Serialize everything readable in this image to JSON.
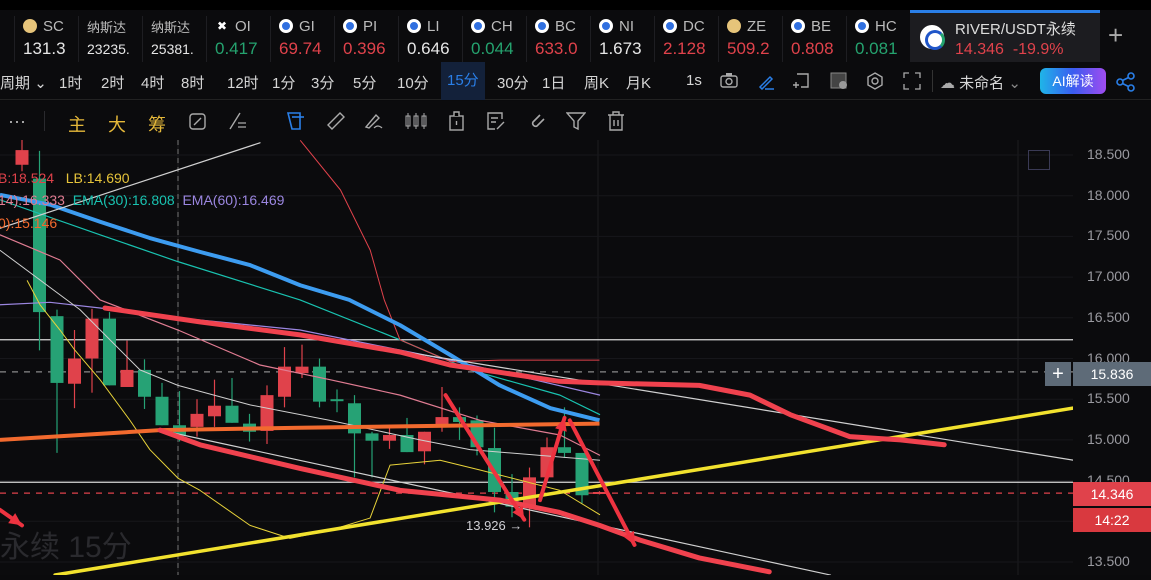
{
  "ticker": [
    {
      "name": "SC",
      "icon": "gold",
      "value": "131.3",
      "color": "w"
    },
    {
      "name": "纳斯达",
      "icon": "",
      "value": "23235.",
      "color": "w"
    },
    {
      "name": "纳斯达",
      "icon": "",
      "value": "25381.",
      "color": "w"
    },
    {
      "name": "OI",
      "icon": "x",
      "value": "0.417",
      "color": "g"
    },
    {
      "name": "GI",
      "icon": "blue",
      "value": "69.74",
      "color": "r"
    },
    {
      "name": "PI",
      "icon": "blue",
      "value": "0.396",
      "color": "r"
    },
    {
      "name": "LI",
      "icon": "blue",
      "value": "0.646",
      "color": "w"
    },
    {
      "name": "CH",
      "icon": "blue",
      "value": "0.044",
      "color": "g"
    },
    {
      "name": "BC",
      "icon": "blue",
      "value": "633.0",
      "color": "r"
    },
    {
      "name": "NI",
      "icon": "blue",
      "value": "1.673",
      "color": "w"
    },
    {
      "name": "DC",
      "icon": "blue",
      "value": "2.128",
      "color": "r"
    },
    {
      "name": "ZE",
      "icon": "gold",
      "value": "509.2",
      "color": "r"
    },
    {
      "name": "BE",
      "icon": "blue",
      "value": "0.808",
      "color": "r"
    },
    {
      "name": "HC",
      "icon": "blue",
      "value": "0.081",
      "color": "g"
    }
  ],
  "active_tab": {
    "symbol": "RIVER/USDT永续",
    "price": "14.346",
    "change": "-19.9%"
  },
  "periods": {
    "label": "周期",
    "items": [
      "1时",
      "2时",
      "4时",
      "8时",
      "12时",
      "1分",
      "3分",
      "5分",
      "10分",
      "15分",
      "30分",
      "1日",
      "周K",
      "月K"
    ],
    "active": "15分",
    "seconds": "1s",
    "layout_name": "未命名",
    "ai_button": "AI解读"
  },
  "tools": {
    "main": "主",
    "big": "大",
    "chips": "筹"
  },
  "legend": {
    "l1a": "B:18.524",
    "l1b": "LB:14.690",
    "l2a": "14):16.333",
    "l2b": "EMA(30):16.808",
    "l2c": "EMA(60):16.469",
    "l3": "0):15.146"
  },
  "watermark": "永续 15分",
  "low_label": "13.926 →",
  "price_axis": {
    "ticks": [
      "18.500",
      "18.000",
      "17.500",
      "17.000",
      "16.500",
      "16.000",
      "15.500",
      "15.000",
      "14.500",
      "14.000",
      "13.500"
    ],
    "crosshair_price": "15.836",
    "last_price": "14.346",
    "countdown": "14:22"
  },
  "colors": {
    "up": "#26a275",
    "down": "#e0424b",
    "accent": "#2a7fe8"
  },
  "chart_data": {
    "type": "candlestick",
    "symbol": "RIVER/USDT永续",
    "interval": "15分",
    "ylim": [
      13.3,
      18.7
    ],
    "candles_ohlc": [
      [
        18.56,
        18.7,
        18.3,
        18.38
      ],
      [
        16.57,
        18.55,
        16.1,
        18.21
      ],
      [
        15.7,
        16.6,
        14.84,
        16.52
      ],
      [
        16.0,
        16.35,
        15.39,
        15.69
      ],
      [
        16.49,
        16.61,
        15.58,
        16.0
      ],
      [
        15.67,
        16.57,
        15.67,
        16.49
      ],
      [
        15.86,
        16.22,
        15.65,
        15.65
      ],
      [
        15.53,
        15.99,
        15.38,
        15.86
      ],
      [
        15.18,
        15.7,
        15.18,
        15.53
      ],
      [
        15.06,
        15.6,
        14.98,
        15.18
      ],
      [
        15.32,
        15.5,
        15.04,
        15.16
      ],
      [
        15.42,
        15.74,
        15.16,
        15.29
      ],
      [
        15.21,
        15.76,
        15.21,
        15.42
      ],
      [
        15.1,
        15.32,
        14.98,
        15.2
      ],
      [
        15.55,
        15.67,
        14.95,
        15.11
      ],
      [
        15.9,
        16.14,
        15.4,
        15.53
      ],
      [
        15.9,
        16.17,
        15.76,
        15.82
      ],
      [
        15.47,
        16.0,
        15.4,
        15.9
      ],
      [
        15.48,
        15.62,
        15.34,
        15.5
      ],
      [
        15.08,
        15.55,
        14.54,
        15.45
      ],
      [
        14.99,
        15.1,
        14.54,
        15.08
      ],
      [
        15.06,
        15.18,
        14.89,
        14.99
      ],
      [
        14.85,
        15.27,
        14.85,
        15.06
      ],
      [
        15.1,
        15.1,
        14.7,
        14.86
      ],
      [
        15.28,
        15.65,
        15.1,
        15.18
      ],
      [
        15.22,
        15.4,
        15.0,
        15.28
      ],
      [
        14.91,
        15.3,
        14.81,
        15.24
      ],
      [
        14.36,
        15.15,
        14.11,
        14.9
      ],
      [
        14.18,
        14.58,
        14.05,
        14.36
      ],
      [
        14.54,
        14.66,
        13.926,
        14.16
      ],
      [
        14.91,
        15.03,
        14.5,
        14.54
      ],
      [
        14.84,
        15.4,
        14.78,
        14.91
      ],
      [
        14.32,
        14.84,
        14.22,
        14.84
      ],
      [
        14.36,
        14.37,
        14.33,
        14.346
      ]
    ],
    "indicator_lines": [
      {
        "name": "ema-30",
        "color": "#19c2b0",
        "width": 1.2,
        "points": [
          [
            -1.26,
            17.95
          ],
          [
            4.46,
            17.52
          ],
          [
            8.91,
            17.19
          ],
          [
            15.89,
            16.72
          ],
          [
            21.6,
            16.23
          ],
          [
            25.6,
            15.86
          ],
          [
            30.74,
            15.55
          ],
          [
            33.03,
            15.31
          ]
        ]
      },
      {
        "name": "ema-60",
        "color": "#9b86e0",
        "width": 1.2,
        "points": [
          [
            -1.26,
            16.66
          ],
          [
            1.6,
            16.69
          ],
          [
            4.46,
            16.62
          ],
          [
            8.91,
            16.5
          ],
          [
            15.89,
            16.35
          ],
          [
            24.46,
            15.98
          ],
          [
            33.03,
            15.55
          ]
        ]
      },
      {
        "name": "ma-pink",
        "color": "#e07c92",
        "width": 1.2,
        "points": [
          [
            -1.26,
            17.52
          ],
          [
            2.17,
            17.21
          ],
          [
            4.46,
            16.72
          ],
          [
            8.91,
            16.35
          ],
          [
            13.6,
            15.92
          ],
          [
            17.6,
            15.74
          ],
          [
            21.6,
            15.55
          ],
          [
            26.17,
            15.24
          ],
          [
            30.74,
            15.06
          ],
          [
            33.03,
            14.81
          ]
        ]
      },
      {
        "name": "ma-white",
        "color": "#cfcfcf",
        "width": 1,
        "points": [
          [
            -1.26,
            17.33
          ],
          [
            3.31,
            16.6
          ],
          [
            6.74,
            15.86
          ],
          [
            8.91,
            15.67
          ],
          [
            13.03,
            15.43
          ],
          [
            17.6,
            15.24
          ],
          [
            22.74,
            15.0
          ],
          [
            25.6,
            14.88
          ],
          [
            30.74,
            14.79
          ],
          [
            33.03,
            14.75
          ]
        ]
      },
      {
        "name": "lb-yellow",
        "color": "#e8d33a",
        "width": 1,
        "points": [
          [
            0.29,
            16.96
          ],
          [
            1.03,
            16.66
          ],
          [
            2.17,
            16.35
          ],
          [
            3.03,
            16.1
          ],
          [
            4.46,
            15.74
          ],
          [
            6.17,
            15.24
          ],
          [
            7.31,
            14.88
          ],
          [
            8.91,
            14.53
          ],
          [
            10.17,
            14.38
          ],
          [
            13.03,
            13.95
          ],
          [
            15.31,
            13.79
          ],
          [
            17.6,
            13.89
          ],
          [
            19.89,
            14.04
          ],
          [
            21.03,
            14.69
          ],
          [
            23.89,
            14.75
          ],
          [
            26.17,
            14.63
          ],
          [
            30.74,
            14.38
          ],
          [
            33.03,
            14.08
          ]
        ]
      },
      {
        "name": "ma-red-thin",
        "color": "#e0424b",
        "width": 1,
        "points": [
          [
            15.9,
            18.68
          ],
          [
            18.2,
            18.07
          ],
          [
            19.9,
            17.33
          ],
          [
            20.7,
            16.72
          ],
          [
            21.6,
            16.23
          ],
          [
            24.5,
            15.96
          ],
          [
            27.3,
            15.98
          ],
          [
            33.0,
            15.98
          ]
        ]
      },
      {
        "name": "ema-blue",
        "color": "#3d9cf0",
        "width": 4,
        "points": [
          [
            -1.26,
            18.01
          ],
          [
            1.6,
            17.89
          ],
          [
            4.46,
            17.68
          ],
          [
            7.3,
            17.48
          ],
          [
            10.17,
            17.31
          ],
          [
            13.0,
            17.15
          ],
          [
            15.9,
            16.9
          ],
          [
            18.7,
            16.72
          ],
          [
            21.6,
            16.41
          ],
          [
            24.5,
            16.04
          ],
          [
            27.3,
            15.67
          ],
          [
            30.2,
            15.39
          ],
          [
            33.0,
            15.24
          ]
        ]
      },
      {
        "name": "ema-orange",
        "color": "#f26a2e",
        "width": 4,
        "points": [
          [
            -1.26,
            15.0
          ],
          [
            7.9,
            15.12
          ],
          [
            15.9,
            15.15
          ],
          [
            33.0,
            15.2
          ]
        ]
      }
    ],
    "drawings": [
      {
        "name": "trend-line-white-top",
        "color": "#d0d0d0",
        "width": 1.2,
        "points": [
          [
            -1.26,
            17.6
          ],
          [
            13.6,
            18.65
          ]
        ]
      },
      {
        "name": "channel-line-upper",
        "color": "#d0d0d0",
        "width": 1.2,
        "points": [
          [
            15.9,
            16.29
          ],
          [
            60.1,
            14.75
          ]
        ]
      },
      {
        "name": "channel-line-lower",
        "color": "#d0d0d0",
        "width": 1.2,
        "points": [
          [
            7.89,
            15.12
          ],
          [
            46.2,
            13.34
          ]
        ]
      },
      {
        "name": "trend-line-yellow",
        "color": "#f2e22e",
        "width": 3.5,
        "points": [
          [
            1.89,
            13.34
          ],
          [
            60.06,
            15.39
          ]
        ]
      },
      {
        "name": "freehand-red-upper",
        "color": "#f0424e",
        "width": 5,
        "points": [
          [
            4.74,
            16.62
          ],
          [
            10.17,
            16.45
          ],
          [
            15.89,
            16.29
          ],
          [
            21.6,
            16.08
          ],
          [
            24.46,
            15.92
          ],
          [
            27.3,
            15.83
          ],
          [
            30.7,
            15.72
          ],
          [
            33.0,
            15.7
          ],
          [
            38.7,
            15.67
          ],
          [
            41.6,
            15.55
          ],
          [
            43.9,
            15.31
          ],
          [
            47.3,
            15.04
          ],
          [
            50.2,
            15.0
          ],
          [
            52.7,
            14.94
          ]
        ]
      },
      {
        "name": "freehand-red-lower",
        "color": "#f0424e",
        "width": 5,
        "points": [
          [
            7.89,
            15.12
          ],
          [
            10.17,
            14.94
          ],
          [
            15.89,
            14.65
          ],
          [
            21.6,
            14.38
          ],
          [
            27.3,
            14.26
          ],
          [
            30.7,
            14.11
          ],
          [
            33.0,
            13.95
          ],
          [
            35.3,
            13.77
          ],
          [
            38.7,
            13.55
          ],
          [
            42.7,
            13.38
          ]
        ]
      }
    ],
    "arrows": [
      {
        "name": "arrow-down-1",
        "points": [
          [
            24.2,
            15.55
          ],
          [
            28.7,
            14.02
          ]
        ]
      },
      {
        "name": "arrow-up",
        "points": [
          [
            29.6,
            14.26
          ],
          [
            31.0,
            15.27
          ]
        ]
      },
      {
        "name": "arrow-down-2",
        "points": [
          [
            31.3,
            15.24
          ],
          [
            35.0,
            13.71
          ]
        ]
      },
      {
        "name": "arrow-left",
        "points": [
          [
            -1.26,
            14.14
          ],
          [
            0,
            13.95
          ]
        ]
      }
    ],
    "hlines": [
      {
        "name": "hline-white-upper",
        "price": 16.23,
        "color": "#d8d8d8",
        "dash": false
      },
      {
        "name": "hline-white-lower",
        "price": 14.48,
        "color": "#d8d8d8",
        "dash": false
      },
      {
        "name": "crosshair-hline",
        "price": 15.836,
        "color": "#8a8a8a",
        "dash": true
      },
      {
        "name": "last-price-line",
        "price": 14.346,
        "color": "#e0424b",
        "dash": true
      }
    ]
  }
}
